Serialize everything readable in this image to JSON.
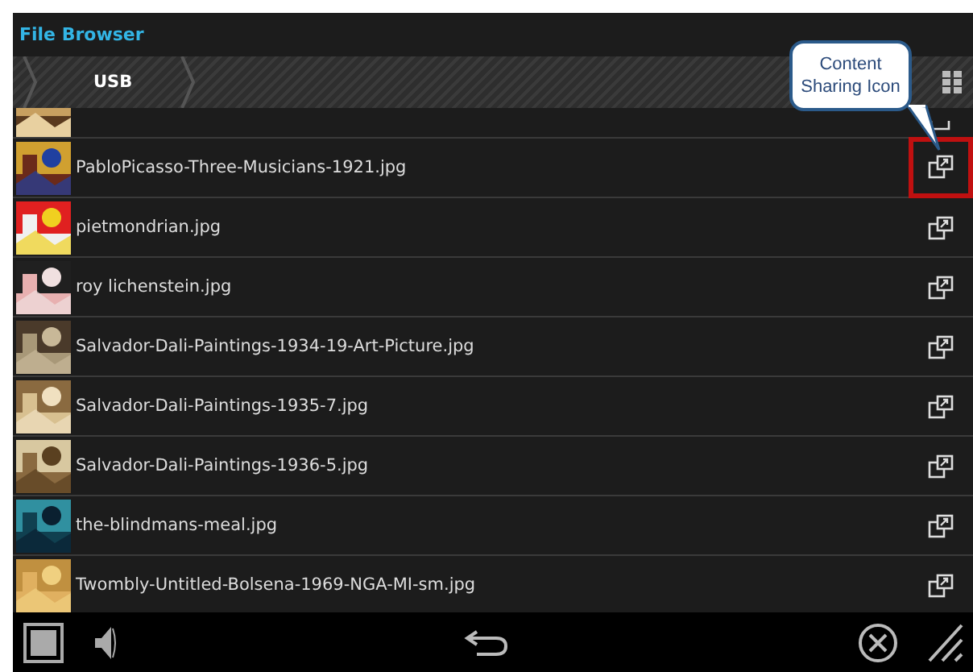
{
  "window": {
    "title": "File Browser"
  },
  "breadcrumb": [
    "USB"
  ],
  "files": [
    {
      "name": "PabloPicasso-Three-Musicians-1921.jpg",
      "highlighted": true
    },
    {
      "name": "pietmondrian.jpg",
      "highlighted": false
    },
    {
      "name": "roy lichenstein.jpg",
      "highlighted": false
    },
    {
      "name": "Salvador-Dali-Paintings-1934-19-Art-Picture.jpg",
      "highlighted": false
    },
    {
      "name": "Salvador-Dali-Paintings-1935-7.jpg",
      "highlighted": false
    },
    {
      "name": "Salvador-Dali-Paintings-1936-5.jpg",
      "highlighted": false
    },
    {
      "name": "the-blindmans-meal.jpg",
      "highlighted": false
    },
    {
      "name": "Twombly-Untitled-Bolsena-1969-NGA-MI-sm.jpg",
      "highlighted": false
    }
  ],
  "callout": {
    "text": "Content Sharing Icon"
  }
}
